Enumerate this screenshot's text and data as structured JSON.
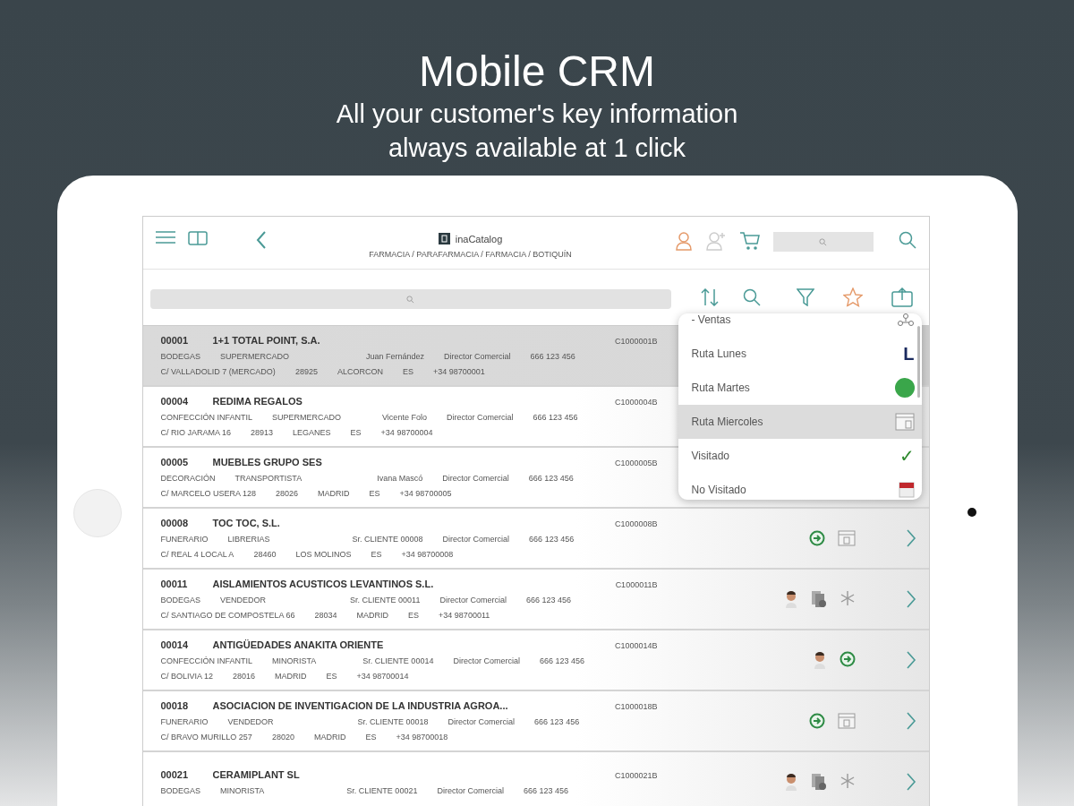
{
  "headline": {
    "title": "Mobile CRM",
    "subtitle_lines": [
      "All your customer's key information",
      "always available at 1 click"
    ]
  },
  "app_header": {
    "logo_text": "inaCatalog",
    "breadcrumb": "FARMACIA / PARAFARMACIA / FARMACIA / BOTIQUÍN"
  },
  "toolbar": {
    "favorites_selected": true
  },
  "customers": [
    {
      "code": "00001",
      "name": "1+1 TOTAL POINT, S.A.",
      "ref": "C1000001B",
      "line2": [
        "BODEGAS",
        "SUPERMERCADO",
        "Juan Fernández",
        "Director Comercial",
        "666 123 456"
      ],
      "line3": [
        "C/ VALLADOLID 7 (MERCADO)",
        "28925",
        "ALCORCON",
        "ES",
        "+34 98700001"
      ],
      "selected": true,
      "chevron": false
    },
    {
      "code": "00004",
      "name": "REDIMA REGALOS",
      "ref": "C1000004B",
      "line2": [
        "CONFECCIÓN INFANTIL",
        "SUPERMERCADO",
        "Vicente Folo",
        "Director Comercial",
        "666 123 456"
      ],
      "line3": [
        "C/ RIO JARAMA 16",
        "28913",
        "LEGANES",
        "ES",
        "+34 98700004"
      ],
      "selected": false,
      "chevron": false
    },
    {
      "code": "00005",
      "name": "MUEBLES GRUPO SES",
      "ref": "C1000005B",
      "line2": [
        "DECORACIÓN",
        "TRANSPORTISTA",
        "Ivana Mascó",
        "Director Comercial",
        "666 123 456"
      ],
      "line3": [
        "C/ MARCELO USERA 128",
        "28026",
        "MADRID",
        "ES",
        "+34 98700005"
      ],
      "selected": false,
      "chevron": false
    },
    {
      "code": "00008",
      "name": "TOC TOC, S.L.",
      "ref": "C1000008B",
      "line2": [
        "FUNERARIO",
        "LIBRERIAS",
        "Sr. CLIENTE 00008",
        "Director Comercial",
        "666 123 456"
      ],
      "line3": [
        "C/ REAL 4 LOCAL A",
        "28460",
        "LOS MOLINOS",
        "ES",
        "+34 98700008"
      ],
      "selected": false,
      "icons": [
        {
          "kind": "arrow-circle"
        },
        {
          "kind": "calendar"
        }
      ],
      "chevron": true
    },
    {
      "code": "00011",
      "name": "AISLAMIENTOS ACUSTICOS LEVANTINOS S.L.",
      "ref": "C1000011B",
      "line2": [
        "BODEGAS",
        "VENDEDOR",
        "Sr. CLIENTE 00011",
        "Director Comercial",
        "666 123 456"
      ],
      "line3": [
        "C/ SANTIAGO DE COMPOSTELA 66",
        "28034",
        "MADRID",
        "ES",
        "+34 98700011"
      ],
      "selected": false,
      "icons": [
        {
          "kind": "person"
        },
        {
          "kind": "documents"
        },
        {
          "kind": "snowflake"
        }
      ],
      "chevron": true
    },
    {
      "code": "00014",
      "name": "ANTIGÜEDADES ANAKITA ORIENTE",
      "ref": "C1000014B",
      "line2": [
        "CONFECCIÓN INFANTIL",
        "MINORISTA",
        "Sr. CLIENTE 00014",
        "Director Comercial",
        "666 123 456"
      ],
      "line3": [
        "C/ BOLIVIA 12",
        "28016",
        "MADRID",
        "ES",
        "+34 98700014"
      ],
      "selected": false,
      "icons": [
        {
          "kind": "person"
        },
        {
          "kind": "arrow-circle"
        }
      ],
      "chevron": true
    },
    {
      "code": "00018",
      "name": "ASOCIACION DE INVENTIGACION DE LA INDUSTRIA AGROA...",
      "ref": "C1000018B",
      "line2": [
        "FUNERARIO",
        "VENDEDOR",
        "Sr. CLIENTE 00018",
        "Director Comercial",
        "666 123 456"
      ],
      "line3": [
        "C/ BRAVO MURILLO 257",
        "28020",
        "MADRID",
        "ES",
        "+34 98700018"
      ],
      "selected": false,
      "icons": [
        {
          "kind": "arrow-circle"
        },
        {
          "kind": "calendar"
        }
      ],
      "chevron": true
    },
    {
      "code": "00021",
      "name": "CERAMIPLANT SL",
      "ref": "C1000021B",
      "line2": [
        "BODEGAS",
        "MINORISTA",
        "Sr. CLIENTE 00021",
        "Director Comercial",
        "666 123 456"
      ],
      "selected": false,
      "icons": [
        {
          "kind": "person"
        },
        {
          "kind": "documents"
        },
        {
          "kind": "snowflake"
        }
      ],
      "chevron": true
    }
  ],
  "favorites_menu": [
    {
      "label": "- Ventas",
      "kind": "network",
      "selected": false
    },
    {
      "label": "Ruta Lunes",
      "kind": "letter",
      "badge": "L",
      "selected": false
    },
    {
      "label": "Ruta Martes",
      "kind": "dot",
      "color": "#3aa64a",
      "selected": false
    },
    {
      "label": "Ruta Miercoles",
      "kind": "calendar",
      "selected": true
    },
    {
      "label": "Visitado",
      "kind": "check",
      "badge": "✓",
      "selected": false
    },
    {
      "label": "No Visitado",
      "kind": "red-calendar",
      "selected": false
    }
  ]
}
